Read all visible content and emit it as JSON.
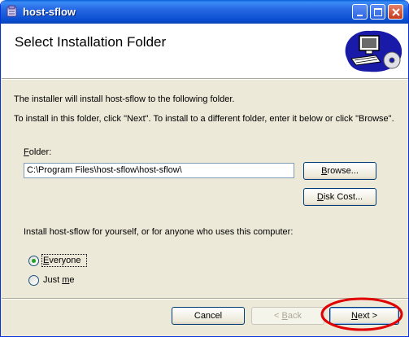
{
  "window": {
    "title": "host-sflow"
  },
  "header": {
    "title": "Select Installation Folder"
  },
  "body": {
    "line1": "The installer will install host-sflow to the following folder.",
    "line2": "To install in this folder, click \"Next\". To install to a different folder, enter it below or click \"Browse\"."
  },
  "folder": {
    "label_prefix": "",
    "label_accel": "F",
    "label_rest": "older:",
    "value": "C:\\Program Files\\host-sflow\\host-sflow\\",
    "browse_accel": "B",
    "browse_rest": "rowse...",
    "diskcost_accel": "D",
    "diskcost_rest": "isk Cost..."
  },
  "install_for": {
    "prompt": "Install host-sflow for yourself, or for anyone who uses this computer:",
    "everyone_accel": "E",
    "everyone_rest": "veryone",
    "justme_prefix": "Just ",
    "justme_accel": "m",
    "justme_rest": "e",
    "selected": "Everyone"
  },
  "footer": {
    "cancel": "Cancel",
    "back_prefix": "< ",
    "back_accel": "B",
    "back_rest": "ack",
    "next_accel": "N",
    "next_rest": "ext >"
  },
  "colors": {
    "annotation": "#e00000",
    "radio_selected": "#21a121",
    "titlebar": "#0a4ed0"
  }
}
